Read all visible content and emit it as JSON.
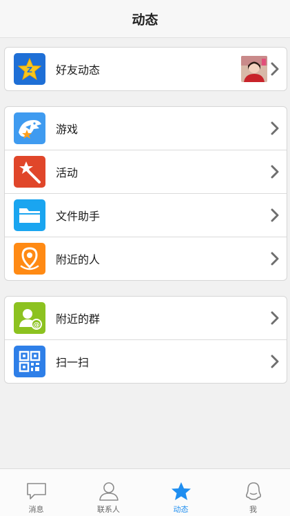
{
  "header": {
    "title": "动态"
  },
  "groups": [
    {
      "items": [
        {
          "label": "好友动态",
          "icon": "qzone-star-icon",
          "color": "#1e6fd6"
        }
      ]
    },
    {
      "items": [
        {
          "label": "游戏",
          "icon": "game-shark-icon",
          "color": "#3f9bf0"
        },
        {
          "label": "活动",
          "icon": "magic-wand-icon",
          "color": "#e0462a"
        },
        {
          "label": "文件助手",
          "icon": "folder-icon",
          "color": "#1aa5f0"
        },
        {
          "label": "附近的人",
          "icon": "location-pin-icon",
          "color": "#ff8a14"
        }
      ]
    },
    {
      "items": [
        {
          "label": "附近的群",
          "icon": "group-at-icon",
          "color": "#8cc220"
        },
        {
          "label": "扫一扫",
          "icon": "qr-code-icon",
          "color": "#2e7fe8"
        }
      ]
    }
  ],
  "tabbar": {
    "tabs": [
      {
        "label": "消息",
        "icon": "chat-bubble-icon"
      },
      {
        "label": "联系人",
        "icon": "contact-person-icon"
      },
      {
        "label": "动态",
        "icon": "star-icon",
        "active": true
      },
      {
        "label": "我",
        "icon": "penguin-icon"
      }
    ],
    "active_color": "#1f8ef0"
  }
}
